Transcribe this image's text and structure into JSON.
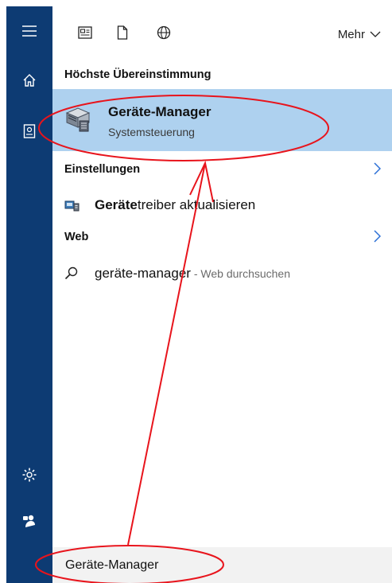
{
  "topbar": {
    "more_label": "Mehr",
    "icons": [
      "app-list-icon",
      "document-icon",
      "globe-icon"
    ]
  },
  "best_match": {
    "heading": "Höchste Übereinstimmung",
    "title": "Geräte-Manager",
    "subtitle": "Systemsteuerung",
    "icon": "device-manager-icon"
  },
  "settings": {
    "heading": "Einstellungen",
    "item_bold": "Geräte",
    "item_rest": "treiber aktualisieren",
    "icon": "driver-settings-icon"
  },
  "web": {
    "heading": "Web",
    "query": "geräte-manager",
    "suffix": " - Web durchsuchen",
    "icon": "search-icon"
  },
  "rail": {
    "items": [
      "menu-icon",
      "home-icon",
      "notebook-icon",
      "settings-gear-icon",
      "feedback-icon"
    ]
  },
  "search": {
    "value": "Geräte-Manager"
  },
  "colors": {
    "rail": "#0d3b73",
    "highlight": "#aed1ef",
    "annotation": "#e8141c",
    "accent": "#2b6fd6"
  }
}
